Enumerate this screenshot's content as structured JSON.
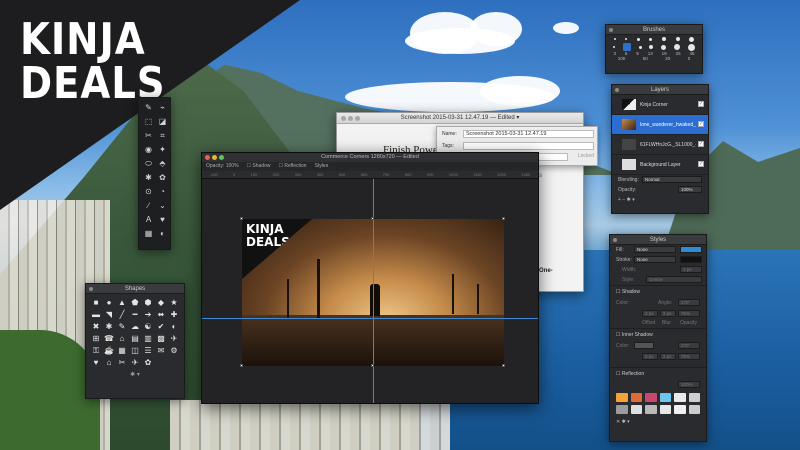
{
  "banner": {
    "line1": "KINJA",
    "line2": "DEALS"
  },
  "tools": {
    "icons": [
      "✎",
      "⌁",
      "⬚",
      "◪",
      "✂",
      "⌗",
      "◉",
      "✦",
      "⬭",
      "⬘",
      "✱",
      "✿",
      "⊙",
      "◔",
      "∕",
      "⌄",
      "A",
      "♥",
      "▦",
      "◐"
    ]
  },
  "shapes_panel": {
    "title": "Shapes",
    "icons": [
      "■",
      "●",
      "▲",
      "⬟",
      "⬢",
      "◆",
      "★",
      "▬",
      "◥",
      "╱",
      "━",
      "➔",
      "⬌",
      "✚",
      "✖",
      "✱",
      "✎",
      "☁",
      "☯",
      "✔",
      "◐",
      "⊞",
      "☎",
      "⌂",
      "▤",
      "▥",
      "▩",
      "✈",
      "⚿",
      "☕",
      "▦",
      "◫",
      "☰",
      "✉",
      "⚙",
      "♥",
      "⌂",
      "✂",
      "✈",
      "✿"
    ],
    "footer": "✱ ▾"
  },
  "notes_window": {
    "title": "Screenshot 2015-03-31 12.47.19 — Edited ▾",
    "headline": "Finish Powerb",
    "link_text": "s",
    "side_text": "One-"
  },
  "popover": {
    "name_label": "Name:",
    "name_value": "Screenshot 2015-03-31 12.47.19",
    "tags_label": "Tags:",
    "locked": "Locked"
  },
  "editor": {
    "title": "Commerce Corners 1280x720 — Edited",
    "toolbar": [
      "Opacity: 100%",
      "☐ Shadow",
      "☐ Reflection",
      "Styles"
    ],
    "ruler_ticks": [
      "-100",
      "0",
      "100",
      "200",
      "300",
      "400",
      "500",
      "600",
      "700",
      "800",
      "900",
      "1000",
      "1100",
      "1200",
      "1300"
    ],
    "art_line1": "KINJA",
    "art_line2": "DEALS"
  },
  "brushes_panel": {
    "title": "Brushes",
    "row1_labels": [],
    "row2_labels": [
      "3",
      "5",
      "9",
      "13",
      "19",
      "25",
      "45"
    ],
    "row3_labels": [
      "100",
      "50",
      "20",
      "0"
    ]
  },
  "layers_panel": {
    "title": "Layers",
    "layers": [
      {
        "name": "Kinja Corner",
        "checked": true,
        "selected": false
      },
      {
        "name": "lone_wanderer_hwaked_...",
        "checked": true,
        "selected": true
      },
      {
        "name": "61FLWHnJcG._SL1000_-1",
        "checked": true,
        "selected": false
      },
      {
        "name": "Background Layer",
        "checked": true,
        "selected": false
      }
    ],
    "blending_label": "Blending:",
    "blending_value": "Normal",
    "opacity_label": "Opacity:",
    "opacity_value": "100%",
    "footer": "+  −     ✱ ▾"
  },
  "styles_panel": {
    "title": "Styles",
    "fill_label": "Fill:",
    "fill_value": "None",
    "stroke_label": "Stroke:",
    "stroke_value": "None",
    "width_label": "Width:",
    "width_value": "1 px",
    "style_label": "Style:",
    "style_value": "Centre",
    "shadow_label": "Shadow",
    "shadow_fields": [
      "Color:",
      "Angle:",
      "270°",
      "2 px",
      "2 px",
      "75%",
      "Offset",
      "Blur",
      "Opacity"
    ],
    "inner_shadow_label": "Inner Shadow",
    "reflection_label": "Reflection",
    "reflection_opacity": "100%",
    "swatch_colors": [
      "#f2a33a",
      "#e06a3a",
      "#c9476e",
      "#6cc6f0",
      "#eaeaea",
      "#cfcfcf",
      "#9b9b9b",
      "#dfdfdf",
      "#b9b9b9",
      "#e8e8e8",
      "#f0f0f0",
      "#cccccc"
    ],
    "footer": "✕        ✱ ▾"
  }
}
